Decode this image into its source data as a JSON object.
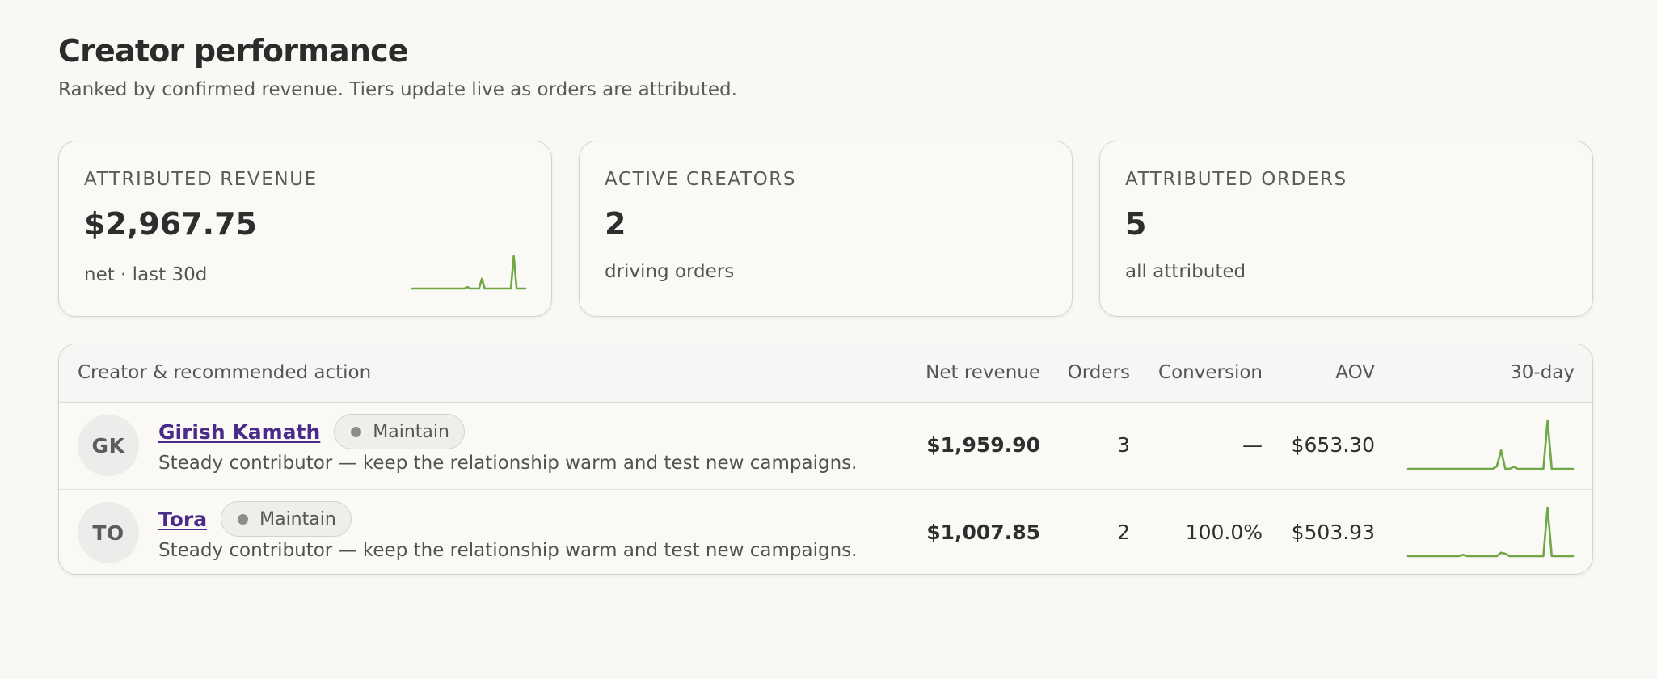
{
  "page": {
    "title": "Creator performance",
    "subtitle": "Ranked by confirmed revenue. Tiers update live as orders are attributed."
  },
  "cards": [
    {
      "label": "ATTRIBUTED REVENUE",
      "value": "$2,967.75",
      "note": "net · last 30d",
      "sparkline": [
        0,
        0,
        0,
        0,
        0,
        0,
        0,
        0,
        0,
        0,
        0,
        0,
        0,
        0,
        0,
        0,
        0,
        0,
        0,
        0.05,
        0,
        0,
        0,
        0,
        0.3,
        0,
        0,
        0,
        0,
        0,
        0,
        0,
        0,
        0,
        0,
        1,
        0,
        0,
        0,
        0
      ]
    },
    {
      "label": "ACTIVE CREATORS",
      "value": "2",
      "note": "driving orders"
    },
    {
      "label": "ATTRIBUTED ORDERS",
      "value": "5",
      "note": "all attributed"
    }
  ],
  "table": {
    "headers": {
      "creator": "Creator & recommended action",
      "net_revenue": "Net revenue",
      "orders": "Orders",
      "conversion": "Conversion",
      "aov": "AOV",
      "trend": "30-day"
    },
    "rows": [
      {
        "initials": "GK",
        "name": "Girish Kamath",
        "tier": "Maintain",
        "action": "Steady contributor — keep the relationship warm and test new campaigns.",
        "net_revenue": "$1,959.90",
        "orders": "3",
        "conversion": "—",
        "aov": "$653.30",
        "sparkline": [
          0,
          0,
          0,
          0,
          0,
          0,
          0,
          0,
          0,
          0,
          0,
          0,
          0,
          0,
          0,
          0,
          0,
          0,
          0,
          0,
          0,
          0.05,
          0.38,
          0,
          0,
          0.04,
          0,
          0,
          0,
          0,
          0,
          0,
          0,
          1,
          0,
          0,
          0,
          0,
          0,
          0
        ]
      },
      {
        "initials": "TO",
        "name": "Tora",
        "tier": "Maintain",
        "action": "Steady contributor — keep the relationship warm and test new campaigns.",
        "net_revenue": "$1,007.85",
        "orders": "2",
        "conversion": "100.0%",
        "aov": "$503.93",
        "sparkline": [
          0,
          0,
          0,
          0,
          0,
          0,
          0,
          0,
          0,
          0,
          0,
          0,
          0,
          0.03,
          0,
          0,
          0,
          0,
          0,
          0,
          0,
          0,
          0.07,
          0.05,
          0,
          0,
          0,
          0,
          0,
          0,
          0,
          0,
          0,
          1,
          0,
          0,
          0,
          0,
          0,
          0
        ]
      }
    ]
  },
  "colors": {
    "sparkline": "#6fa844",
    "link": "#4a2b8a",
    "badge_dot": "#8a8d89"
  }
}
